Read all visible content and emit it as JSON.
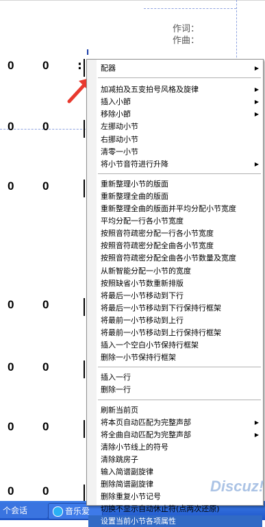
{
  "score": {
    "credits": {
      "lyricist": "作词：",
      "composer": "作曲："
    },
    "cursor_glyph": "I",
    "rows": [
      {
        "notes": [
          "0",
          "0"
        ],
        "colon": ":"
      },
      {
        "notes": [
          "0",
          "0"
        ],
        "colon": ""
      },
      {
        "notes": [
          "0",
          "0"
        ],
        "colon": ""
      },
      {
        "notes": [
          "0",
          "0"
        ],
        "colon": ""
      },
      {
        "notes": [
          "0",
          "0"
        ],
        "colon": ""
      },
      {
        "notes": [
          "0",
          "0"
        ],
        "colon": ""
      },
      {
        "notes": [
          "0",
          "0"
        ],
        "colon": ""
      }
    ]
  },
  "context_menu": {
    "groups": [
      [
        {
          "label": "配器",
          "submenu": true
        }
      ],
      [
        {
          "label": "加减拍及五变拍号风格及旋律",
          "submenu": true
        },
        {
          "label": "插入小節",
          "submenu": true
        },
        {
          "label": "移除小節",
          "submenu": true
        },
        {
          "label": "左挪动小节",
          "submenu": false
        },
        {
          "label": "右挪动小节",
          "submenu": false
        },
        {
          "label": "清零一小节",
          "submenu": false
        },
        {
          "label": "将小节音符进行升降",
          "submenu": true
        }
      ],
      [
        {
          "label": "重新整理小节的版面",
          "submenu": false
        },
        {
          "label": "重新整理全曲的版面",
          "submenu": false
        },
        {
          "label": "重新整理全曲的版面并平均分配小节宽度",
          "submenu": false
        },
        {
          "label": "平均分配一行各小节宽度",
          "submenu": false
        },
        {
          "label": "按照音符疏密分配一行各小节宽度",
          "submenu": false
        },
        {
          "label": "按照音符疏密分配全曲各小节宽度",
          "submenu": false
        },
        {
          "label": "按照音符疏密分配全曲各小节数量及宽度",
          "submenu": false
        },
        {
          "label": "从新智能分配一小节的宽度",
          "submenu": false
        },
        {
          "label": "按照缺省小节数重新排版",
          "submenu": false
        },
        {
          "label": "将最后一小节移动到下行",
          "submenu": false
        },
        {
          "label": "将最后一小节移动到下行保持行框架",
          "submenu": false
        },
        {
          "label": "将最前一小节移动到上行",
          "submenu": false
        },
        {
          "label": "将最前一小节移动到上行保持行框架",
          "submenu": false
        },
        {
          "label": "插入一个空白小节保持行框架",
          "submenu": false
        },
        {
          "label": "删除一小节保持行框架",
          "submenu": false
        }
      ],
      [
        {
          "label": "插入一行",
          "submenu": false
        },
        {
          "label": "删除一行",
          "submenu": false
        }
      ],
      [
        {
          "label": "刷新当前页",
          "submenu": false
        },
        {
          "label": "将本页自动匹配为完整声部",
          "submenu": true
        },
        {
          "label": "将全曲自动匹配为完整声部",
          "submenu": true
        },
        {
          "label": "清除小节线上的符号",
          "submenu": false
        },
        {
          "label": "清除跳房子",
          "submenu": false
        },
        {
          "label": "输入简谱副旋律",
          "submenu": false
        },
        {
          "label": "删除简谱副旋律",
          "submenu": false
        },
        {
          "label": "删除重复小节记号",
          "submenu": false
        },
        {
          "label": "切换不显示自动休止符(点两次还原)",
          "submenu": false
        },
        {
          "label": "设置当前小节各项属性",
          "submenu": false,
          "selected": true
        }
      ]
    ]
  },
  "taskbar": {
    "items": [
      {
        "label": "个会话",
        "icon": "chat-icon"
      },
      {
        "label": "音乐爱",
        "icon": "ie-globe-icon"
      }
    ]
  },
  "watermark": "Discuz!",
  "colors": {
    "menu_highlight": "#316ac5",
    "arrow": "#e8392e",
    "taskbar": "#2a63d6"
  }
}
